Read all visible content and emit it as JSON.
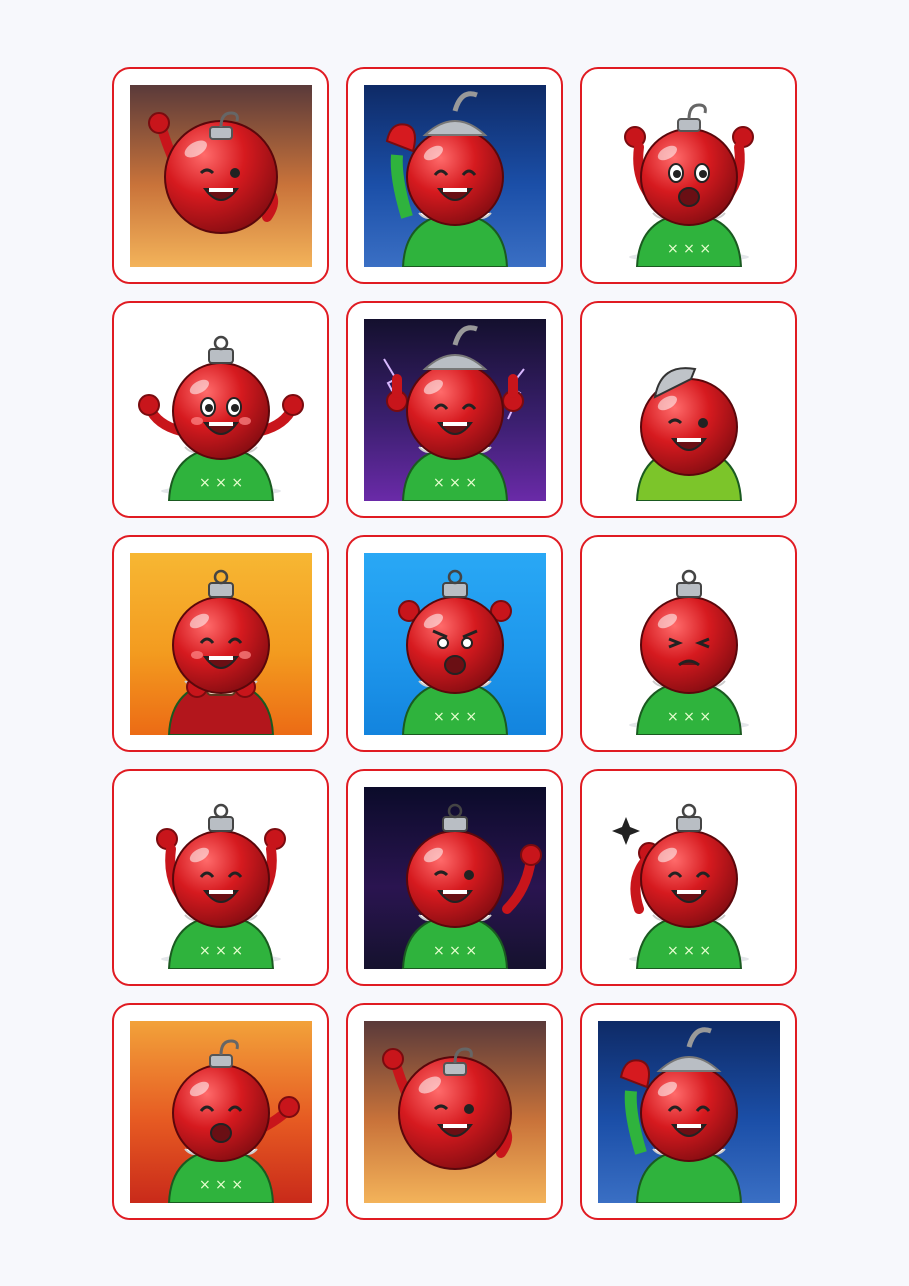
{
  "stickers": [
    {
      "id": "wave-sunset",
      "bg": "sunset",
      "suit": "none",
      "cap": "hook",
      "pose": "wave",
      "face": "wink",
      "blush": false,
      "sparkle": false
    },
    {
      "id": "mitten-hello",
      "bg": "night",
      "suit": "leaf",
      "cap": "silver-tall",
      "pose": "mitten-wave",
      "face": "joy",
      "blush": false,
      "sparkle": false
    },
    {
      "id": "boxing-cheer",
      "bg": "white",
      "suit": "green",
      "cap": "hook",
      "pose": "gloves-up",
      "face": "starry",
      "blush": false,
      "sparkle": false
    },
    {
      "id": "happy-hello",
      "bg": "white",
      "suit": "green",
      "cap": "ornament",
      "pose": "arms-out",
      "face": "bigeyes",
      "blush": true,
      "sparkle": false
    },
    {
      "id": "thumbs-electric",
      "bg": "purple",
      "suit": "green",
      "cap": "silver-tall",
      "pose": "thumbs",
      "face": "grin",
      "blush": false,
      "sparkle": false
    },
    {
      "id": "breakdance",
      "bg": "white",
      "suit": "polka",
      "cap": "cap",
      "pose": "upside",
      "face": "wink",
      "blush": false,
      "sparkle": false
    },
    {
      "id": "cocoa-sip",
      "bg": "orange",
      "suit": "red-sweater",
      "cap": "ornament",
      "pose": "mug",
      "face": "joy",
      "blush": true,
      "sparkle": false
    },
    {
      "id": "frustrated",
      "bg": "blue",
      "suit": "green",
      "cap": "ornament",
      "pose": "hands-head",
      "face": "angry",
      "blush": false,
      "sparkle": false
    },
    {
      "id": "facepalm",
      "bg": "white",
      "suit": "green",
      "cap": "ornament",
      "pose": "facepalm",
      "face": "pained",
      "blush": false,
      "sparkle": false
    },
    {
      "id": "hooray",
      "bg": "white",
      "suit": "green",
      "cap": "ornament",
      "pose": "fists-up",
      "face": "joy",
      "blush": false,
      "sparkle": false
    },
    {
      "id": "neon-wink",
      "bg": "neon",
      "suit": "green",
      "cap": "ornament",
      "pose": "arm-up",
      "face": "wink-lash",
      "blush": false,
      "sparkle": false
    },
    {
      "id": "salute",
      "bg": "white",
      "suit": "green",
      "cap": "ornament",
      "pose": "salute",
      "face": "grin",
      "blush": false,
      "sparkle": true
    },
    {
      "id": "super-hero",
      "bg": "red-orange",
      "suit": "green",
      "cap": "hook",
      "pose": "point",
      "face": "shout",
      "blush": false,
      "sparkle": false
    },
    {
      "id": "wave-sunset-2",
      "bg": "sunset",
      "suit": "none",
      "cap": "hook",
      "pose": "wave",
      "face": "wink",
      "blush": false,
      "sparkle": false
    },
    {
      "id": "mitten-hello-2",
      "bg": "night",
      "suit": "leaf",
      "cap": "silver-tall",
      "pose": "mitten-wave",
      "face": "joy",
      "blush": false,
      "sparkle": false
    }
  ],
  "colors": {
    "accent_border": "#e01b22",
    "ornament_red": "#d61a1f",
    "ornament_highlight": "#ff6b6b",
    "suit_green": "#2fb33d",
    "cap_silver": "#b9bec4"
  }
}
